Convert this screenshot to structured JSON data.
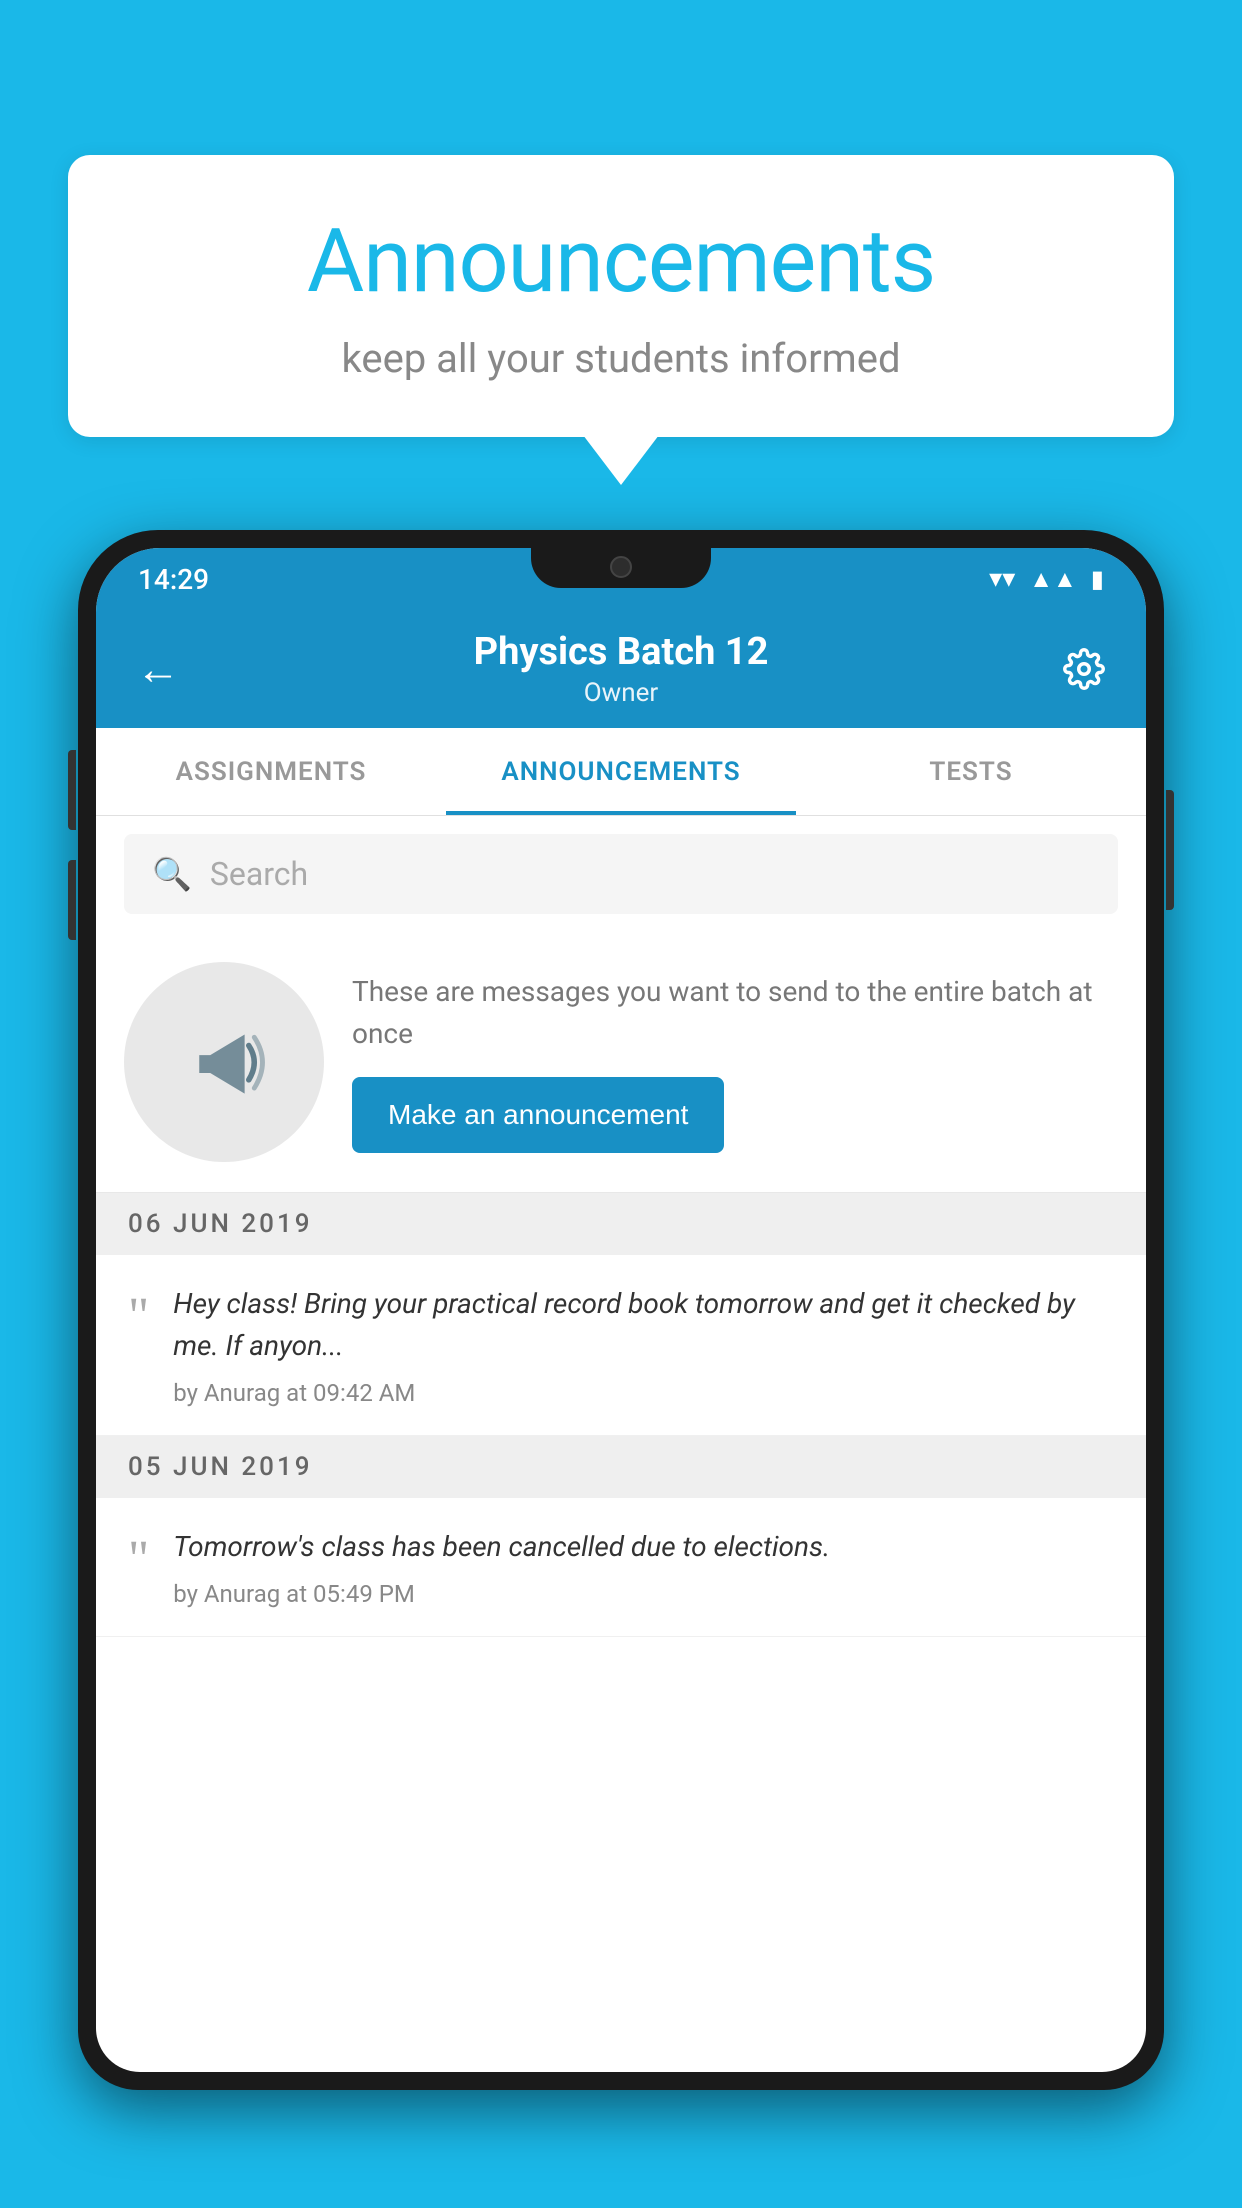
{
  "background_color": "#1ab8e8",
  "bubble": {
    "title": "Announcements",
    "subtitle": "keep all your students informed"
  },
  "phone": {
    "status_bar": {
      "time": "14:29"
    },
    "app_bar": {
      "title": "Physics Batch 12",
      "subtitle": "Owner",
      "back_label": "←",
      "settings_label": "⚙"
    },
    "tabs": [
      {
        "label": "ASSIGNMENTS",
        "active": false
      },
      {
        "label": "ANNOUNCEMENTS",
        "active": true
      },
      {
        "label": "TESTS",
        "active": false
      }
    ],
    "search": {
      "placeholder": "Search"
    },
    "announcement_prompt": {
      "description": "These are messages you want to send to the entire batch at once",
      "button_label": "Make an announcement"
    },
    "announcements": [
      {
        "date": "06  JUN  2019",
        "message": "Hey class! Bring your practical record book tomorrow and get it checked by me. If anyon...",
        "meta": "by Anurag at 09:42 AM"
      },
      {
        "date": "05  JUN  2019",
        "message": "Tomorrow's class has been cancelled due to elections.",
        "meta": "by Anurag at 05:49 PM"
      }
    ]
  }
}
